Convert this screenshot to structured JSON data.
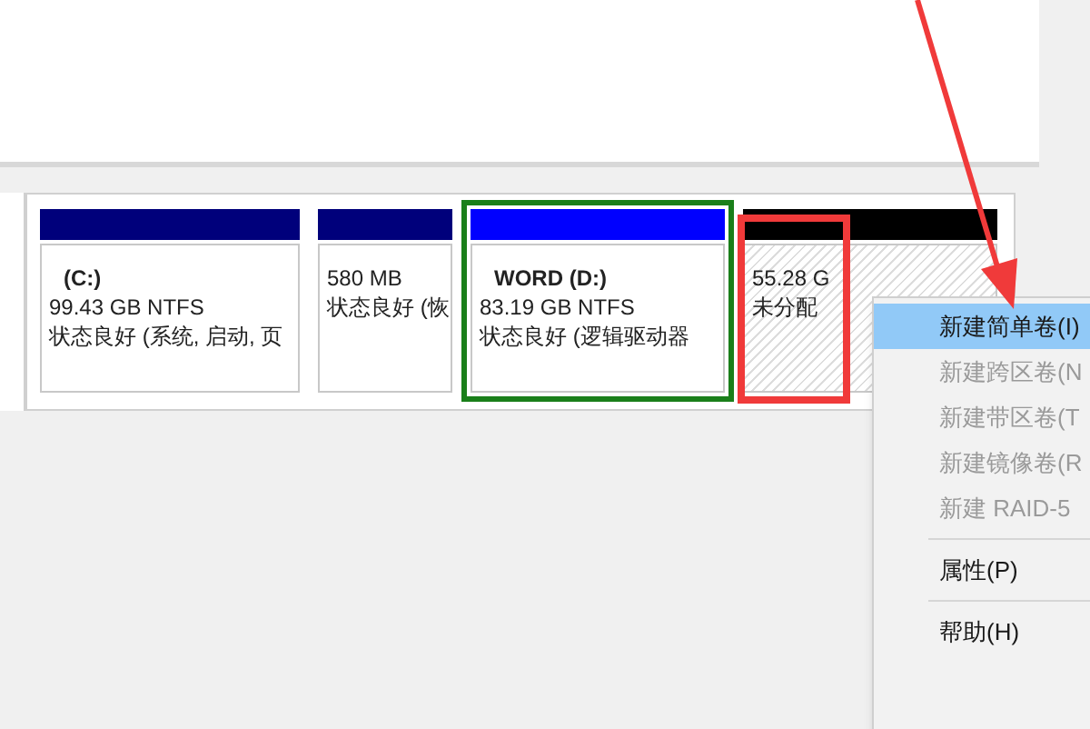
{
  "disk": {
    "partitions": [
      {
        "kind": "primary",
        "selected": false,
        "name": "(C:)",
        "size": "99.43 GB NTFS",
        "status": "状态良好 (系统, 启动, 页"
      },
      {
        "kind": "primary",
        "selected": false,
        "size": "580 MB",
        "status": "状态良好 (恢"
      },
      {
        "kind": "logical",
        "selected": true,
        "name": "WORD  (D:)",
        "size": "83.19 GB NTFS",
        "status": "状态良好 (逻辑驱动器"
      },
      {
        "kind": "unallocated",
        "selected": false,
        "size": "55.28 G",
        "status": "未分配"
      }
    ]
  },
  "context_menu": {
    "groups": [
      [
        {
          "label": "新建简单卷(I)",
          "selected": true,
          "disabled": false
        },
        {
          "label": "新建跨区卷(N",
          "selected": false,
          "disabled": true
        },
        {
          "label": "新建带区卷(T",
          "selected": false,
          "disabled": true
        },
        {
          "label": "新建镜像卷(R",
          "selected": false,
          "disabled": true
        },
        {
          "label": "新建 RAID-5",
          "selected": false,
          "disabled": true
        }
      ],
      [
        {
          "label": "属性(P)",
          "selected": false,
          "disabled": false
        }
      ],
      [
        {
          "label": "帮助(H)",
          "selected": false,
          "disabled": false
        }
      ]
    ]
  }
}
